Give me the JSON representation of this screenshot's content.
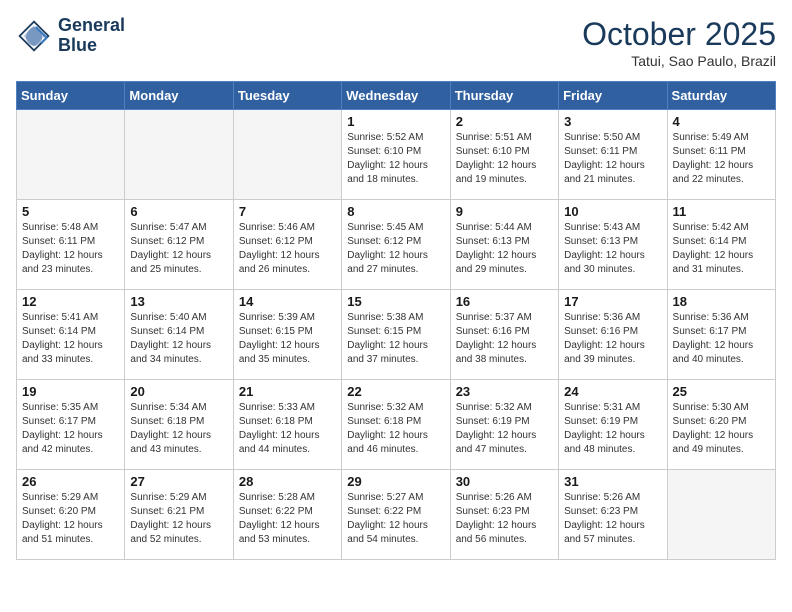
{
  "header": {
    "logo_line1": "General",
    "logo_line2": "Blue",
    "month": "October 2025",
    "location": "Tatui, Sao Paulo, Brazil"
  },
  "days_of_week": [
    "Sunday",
    "Monday",
    "Tuesday",
    "Wednesday",
    "Thursday",
    "Friday",
    "Saturday"
  ],
  "weeks": [
    [
      {
        "num": "",
        "info": ""
      },
      {
        "num": "",
        "info": ""
      },
      {
        "num": "",
        "info": ""
      },
      {
        "num": "1",
        "info": "Sunrise: 5:52 AM\nSunset: 6:10 PM\nDaylight: 12 hours\nand 18 minutes."
      },
      {
        "num": "2",
        "info": "Sunrise: 5:51 AM\nSunset: 6:10 PM\nDaylight: 12 hours\nand 19 minutes."
      },
      {
        "num": "3",
        "info": "Sunrise: 5:50 AM\nSunset: 6:11 PM\nDaylight: 12 hours\nand 21 minutes."
      },
      {
        "num": "4",
        "info": "Sunrise: 5:49 AM\nSunset: 6:11 PM\nDaylight: 12 hours\nand 22 minutes."
      }
    ],
    [
      {
        "num": "5",
        "info": "Sunrise: 5:48 AM\nSunset: 6:11 PM\nDaylight: 12 hours\nand 23 minutes."
      },
      {
        "num": "6",
        "info": "Sunrise: 5:47 AM\nSunset: 6:12 PM\nDaylight: 12 hours\nand 25 minutes."
      },
      {
        "num": "7",
        "info": "Sunrise: 5:46 AM\nSunset: 6:12 PM\nDaylight: 12 hours\nand 26 minutes."
      },
      {
        "num": "8",
        "info": "Sunrise: 5:45 AM\nSunset: 6:12 PM\nDaylight: 12 hours\nand 27 minutes."
      },
      {
        "num": "9",
        "info": "Sunrise: 5:44 AM\nSunset: 6:13 PM\nDaylight: 12 hours\nand 29 minutes."
      },
      {
        "num": "10",
        "info": "Sunrise: 5:43 AM\nSunset: 6:13 PM\nDaylight: 12 hours\nand 30 minutes."
      },
      {
        "num": "11",
        "info": "Sunrise: 5:42 AM\nSunset: 6:14 PM\nDaylight: 12 hours\nand 31 minutes."
      }
    ],
    [
      {
        "num": "12",
        "info": "Sunrise: 5:41 AM\nSunset: 6:14 PM\nDaylight: 12 hours\nand 33 minutes."
      },
      {
        "num": "13",
        "info": "Sunrise: 5:40 AM\nSunset: 6:14 PM\nDaylight: 12 hours\nand 34 minutes."
      },
      {
        "num": "14",
        "info": "Sunrise: 5:39 AM\nSunset: 6:15 PM\nDaylight: 12 hours\nand 35 minutes."
      },
      {
        "num": "15",
        "info": "Sunrise: 5:38 AM\nSunset: 6:15 PM\nDaylight: 12 hours\nand 37 minutes."
      },
      {
        "num": "16",
        "info": "Sunrise: 5:37 AM\nSunset: 6:16 PM\nDaylight: 12 hours\nand 38 minutes."
      },
      {
        "num": "17",
        "info": "Sunrise: 5:36 AM\nSunset: 6:16 PM\nDaylight: 12 hours\nand 39 minutes."
      },
      {
        "num": "18",
        "info": "Sunrise: 5:36 AM\nSunset: 6:17 PM\nDaylight: 12 hours\nand 40 minutes."
      }
    ],
    [
      {
        "num": "19",
        "info": "Sunrise: 5:35 AM\nSunset: 6:17 PM\nDaylight: 12 hours\nand 42 minutes."
      },
      {
        "num": "20",
        "info": "Sunrise: 5:34 AM\nSunset: 6:18 PM\nDaylight: 12 hours\nand 43 minutes."
      },
      {
        "num": "21",
        "info": "Sunrise: 5:33 AM\nSunset: 6:18 PM\nDaylight: 12 hours\nand 44 minutes."
      },
      {
        "num": "22",
        "info": "Sunrise: 5:32 AM\nSunset: 6:18 PM\nDaylight: 12 hours\nand 46 minutes."
      },
      {
        "num": "23",
        "info": "Sunrise: 5:32 AM\nSunset: 6:19 PM\nDaylight: 12 hours\nand 47 minutes."
      },
      {
        "num": "24",
        "info": "Sunrise: 5:31 AM\nSunset: 6:19 PM\nDaylight: 12 hours\nand 48 minutes."
      },
      {
        "num": "25",
        "info": "Sunrise: 5:30 AM\nSunset: 6:20 PM\nDaylight: 12 hours\nand 49 minutes."
      }
    ],
    [
      {
        "num": "26",
        "info": "Sunrise: 5:29 AM\nSunset: 6:20 PM\nDaylight: 12 hours\nand 51 minutes."
      },
      {
        "num": "27",
        "info": "Sunrise: 5:29 AM\nSunset: 6:21 PM\nDaylight: 12 hours\nand 52 minutes."
      },
      {
        "num": "28",
        "info": "Sunrise: 5:28 AM\nSunset: 6:22 PM\nDaylight: 12 hours\nand 53 minutes."
      },
      {
        "num": "29",
        "info": "Sunrise: 5:27 AM\nSunset: 6:22 PM\nDaylight: 12 hours\nand 54 minutes."
      },
      {
        "num": "30",
        "info": "Sunrise: 5:26 AM\nSunset: 6:23 PM\nDaylight: 12 hours\nand 56 minutes."
      },
      {
        "num": "31",
        "info": "Sunrise: 5:26 AM\nSunset: 6:23 PM\nDaylight: 12 hours\nand 57 minutes."
      },
      {
        "num": "",
        "info": ""
      }
    ]
  ]
}
